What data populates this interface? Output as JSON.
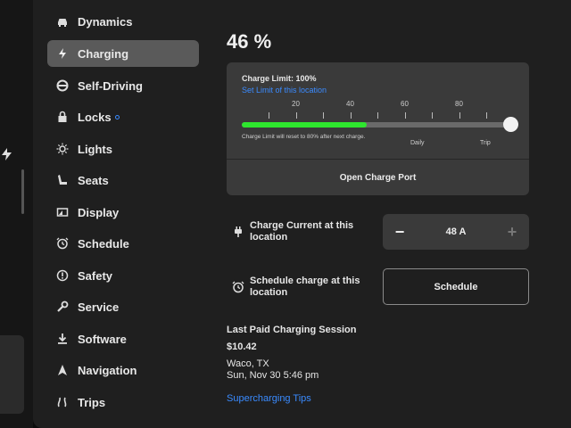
{
  "sidebar": {
    "items": [
      {
        "label": "Dynamics",
        "icon": "car-icon"
      },
      {
        "label": "Charging",
        "icon": "lightning-icon",
        "active": true
      },
      {
        "label": "Self-Driving",
        "icon": "steering-wheel-icon"
      },
      {
        "label": "Locks",
        "icon": "lock-icon",
        "badge": true
      },
      {
        "label": "Lights",
        "icon": "sun-icon"
      },
      {
        "label": "Seats",
        "icon": "seat-icon"
      },
      {
        "label": "Display",
        "icon": "display-icon"
      },
      {
        "label": "Schedule",
        "icon": "alarm-clock-icon"
      },
      {
        "label": "Safety",
        "icon": "info-circle-icon"
      },
      {
        "label": "Service",
        "icon": "wrench-icon"
      },
      {
        "label": "Software",
        "icon": "download-icon"
      },
      {
        "label": "Navigation",
        "icon": "navigation-arrow-icon"
      },
      {
        "label": "Trips",
        "icon": "trips-icon"
      }
    ]
  },
  "charging": {
    "percent": "46 %",
    "charge_limit_label": "Charge Limit: 100%",
    "set_link": "Set Limit of this location",
    "ticks": [
      "20",
      "40",
      "60",
      "80"
    ],
    "battery_level_fraction": 0.46,
    "limit_fraction": 1.0,
    "note": "Charge Limit will reset to 80% after next charge.",
    "daily_label": "Daily",
    "trip_label": "Trip",
    "open_port": "Open Charge Port",
    "current_label": "Charge Current at this location",
    "current_value": "48 A",
    "minus": "−",
    "plus": "+",
    "schedule_label": "Schedule charge at this location",
    "schedule_button": "Schedule",
    "last_session_title": "Last Paid Charging Session",
    "last_session_amount": "$10.42",
    "last_session_place": "Waco, TX",
    "last_session_time": "Sun, Nov 30 5:46 pm",
    "tips_link": "Supercharging Tips"
  },
  "colors": {
    "accent": "#3a8bff",
    "charge": "#2ee62e",
    "background": "#1f1f1f"
  },
  "edge": {
    "bolt": "⚡"
  }
}
